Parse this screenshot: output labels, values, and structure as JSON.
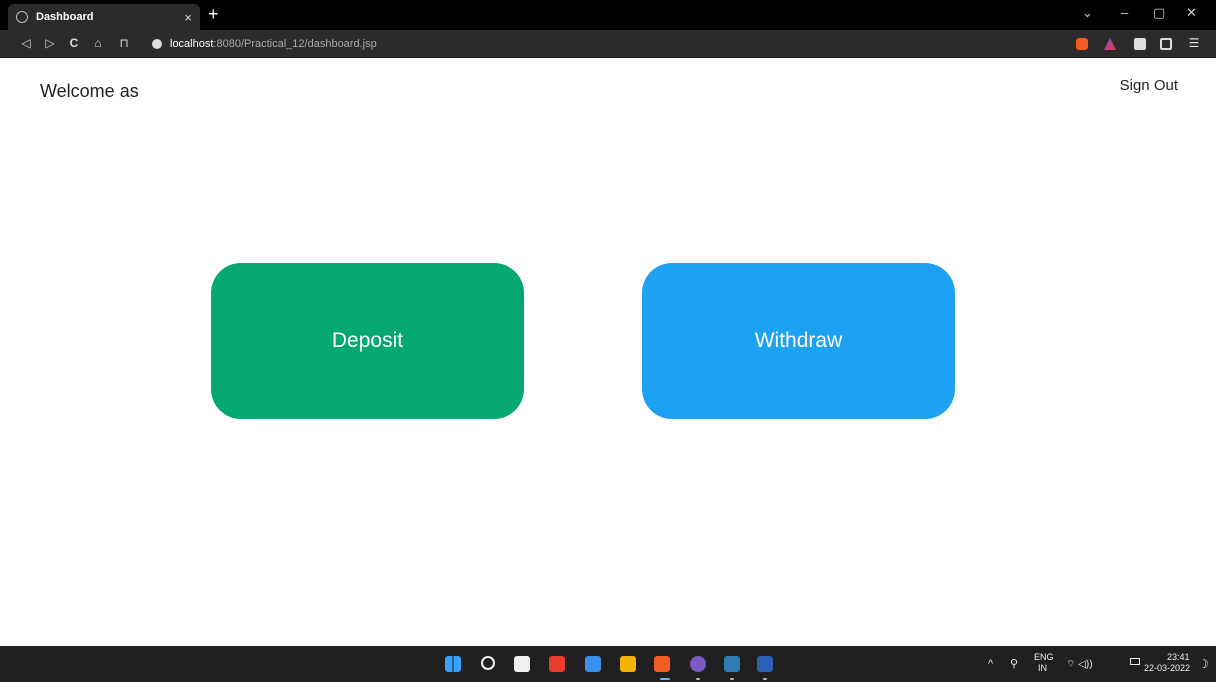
{
  "browser": {
    "tab_title": "Dashboard",
    "tab_close": "×",
    "new_tab": "+",
    "url_host": "localhost",
    "url_path": ":8080/Practical_12/dashboard.jsp",
    "win_minimize": "–",
    "win_restore": "▢",
    "win_close": "✕",
    "win_dropdown": "⌄",
    "nav_back": "◁",
    "nav_forward": "▷",
    "nav_reload": "C",
    "nav_home": "⌂",
    "nav_bookmark": "⊓",
    "menu": "☰"
  },
  "page": {
    "welcome": "Welcome as",
    "sign_out": "Sign Out",
    "deposit": "Deposit",
    "withdraw": "Withdraw"
  },
  "colors": {
    "deposit": "#05a86e",
    "withdraw": "#1da1f2"
  },
  "taskbar": {
    "language_top": "ENG",
    "language_bottom": "IN",
    "time": "23:41",
    "date": "22-03-2022",
    "tray_chevron": "^",
    "tray_icons": "⚲",
    "network_sound": "⌔ ◁))"
  }
}
